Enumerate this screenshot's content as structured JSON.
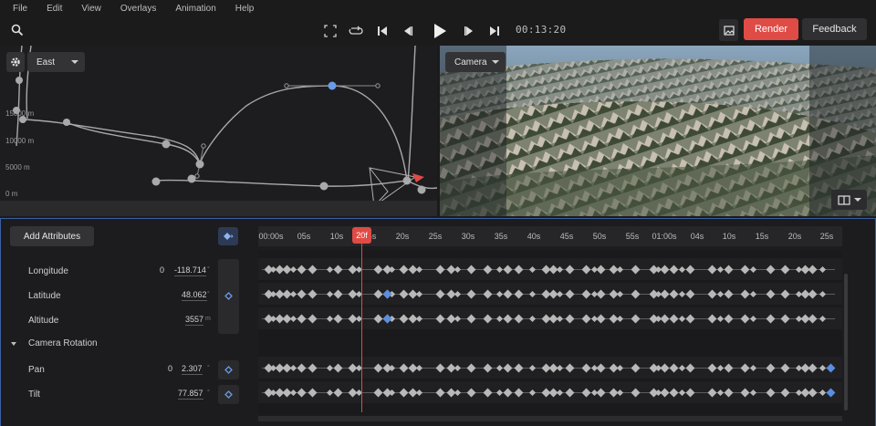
{
  "menu": [
    "File",
    "Edit",
    "View",
    "Overlays",
    "Animation",
    "Help"
  ],
  "toolbar": {
    "time": "00:13:20",
    "render_label": "Render",
    "feedback_label": "Feedback"
  },
  "graph": {
    "direction": "East",
    "altitude_labels": [
      "15000 m",
      "10000 m",
      "5000 m",
      "0 m"
    ]
  },
  "preview": {
    "camera_label": "Camera"
  },
  "timeline": {
    "add_attributes_label": "Add Attributes",
    "playhead_label": "20f",
    "tick_labels": [
      "00:00s",
      "05s",
      "10s",
      "15s",
      "20s",
      "25s",
      "30s",
      "35s",
      "40s",
      "45s",
      "50s",
      "55s",
      "01:00s",
      "04s",
      "10s",
      "15s",
      "20s",
      "25s"
    ],
    "attributes": [
      {
        "name": "Longitude",
        "prefix": "0",
        "value": "-118.714",
        "unit": "°"
      },
      {
        "name": "Latitude",
        "prefix": "",
        "value": "48.062",
        "unit": "°"
      },
      {
        "name": "Altitude",
        "prefix": "",
        "value": "3557",
        "unit": "m"
      }
    ],
    "section": "Camera Rotation",
    "rotation": [
      {
        "name": "Pan",
        "prefix": "0",
        "value": "2.307",
        "unit": "°"
      },
      {
        "name": "Tilt",
        "prefix": "",
        "value": "77.857",
        "unit": "°"
      }
    ]
  },
  "colors": {
    "accent_red": "#df4b45",
    "keyframe_blue": "#5b8ee0"
  }
}
